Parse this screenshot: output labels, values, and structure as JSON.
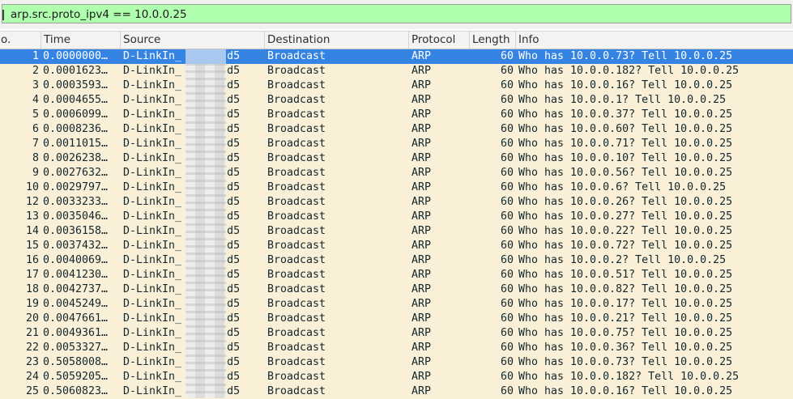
{
  "filter": {
    "value": "arp.src.proto_ipv4 == 10.0.0.25"
  },
  "columns": [
    "o.",
    "Time",
    "Source",
    "Destination",
    "Protocol",
    "Length",
    "Info"
  ],
  "selected_row": 1,
  "rows": [
    {
      "no": "1",
      "time": "0.0000000…",
      "src": "D-LinkIn_",
      "src_tail": ":d5",
      "dst": "Broadcast",
      "proto": "ARP",
      "len": "60",
      "info": "Who has 10.0.0.73? Tell 10.0.0.25"
    },
    {
      "no": "2",
      "time": "0.0001623…",
      "src": "D-LinkIn_",
      "src_tail": ":d5",
      "dst": "Broadcast",
      "proto": "ARP",
      "len": "60",
      "info": "Who has 10.0.0.182? Tell 10.0.0.25"
    },
    {
      "no": "3",
      "time": "0.0003593…",
      "src": "D-LinkIn_",
      "src_tail": ":d5",
      "dst": "Broadcast",
      "proto": "ARP",
      "len": "60",
      "info": "Who has 10.0.0.16? Tell 10.0.0.25"
    },
    {
      "no": "4",
      "time": "0.0004655…",
      "src": "D-LinkIn_",
      "src_tail": ":d5",
      "dst": "Broadcast",
      "proto": "ARP",
      "len": "60",
      "info": "Who has 10.0.0.1? Tell 10.0.0.25"
    },
    {
      "no": "5",
      "time": "0.0006099…",
      "src": "D-LinkIn_",
      "src_tail": ":d5",
      "dst": "Broadcast",
      "proto": "ARP",
      "len": "60",
      "info": "Who has 10.0.0.37? Tell 10.0.0.25"
    },
    {
      "no": "6",
      "time": "0.0008236…",
      "src": "D-LinkIn_",
      "src_tail": ":d5",
      "dst": "Broadcast",
      "proto": "ARP",
      "len": "60",
      "info": "Who has 10.0.0.60? Tell 10.0.0.25"
    },
    {
      "no": "7",
      "time": "0.0011015…",
      "src": "D-LinkIn_",
      "src_tail": ":d5",
      "dst": "Broadcast",
      "proto": "ARP",
      "len": "60",
      "info": "Who has 10.0.0.71? Tell 10.0.0.25"
    },
    {
      "no": "8",
      "time": "0.0026238…",
      "src": "D-LinkIn_",
      "src_tail": ":d5",
      "dst": "Broadcast",
      "proto": "ARP",
      "len": "60",
      "info": "Who has 10.0.0.10? Tell 10.0.0.25"
    },
    {
      "no": "9",
      "time": "0.0027632…",
      "src": "D-LinkIn_",
      "src_tail": ":d5",
      "dst": "Broadcast",
      "proto": "ARP",
      "len": "60",
      "info": "Who has 10.0.0.56? Tell 10.0.0.25"
    },
    {
      "no": "10",
      "time": "0.0029797…",
      "src": "D-LinkIn_",
      "src_tail": ":d5",
      "dst": "Broadcast",
      "proto": "ARP",
      "len": "60",
      "info": "Who has 10.0.0.6? Tell 10.0.0.25"
    },
    {
      "no": "12",
      "time": "0.0033233…",
      "src": "D-LinkIn_",
      "src_tail": ":d5",
      "dst": "Broadcast",
      "proto": "ARP",
      "len": "60",
      "info": "Who has 10.0.0.26? Tell 10.0.0.25"
    },
    {
      "no": "13",
      "time": "0.0035046…",
      "src": "D-LinkIn_",
      "src_tail": ":d5",
      "dst": "Broadcast",
      "proto": "ARP",
      "len": "60",
      "info": "Who has 10.0.0.27? Tell 10.0.0.25"
    },
    {
      "no": "14",
      "time": "0.0036158…",
      "src": "D-LinkIn_",
      "src_tail": ":d5",
      "dst": "Broadcast",
      "proto": "ARP",
      "len": "60",
      "info": "Who has 10.0.0.22? Tell 10.0.0.25"
    },
    {
      "no": "15",
      "time": "0.0037432…",
      "src": "D-LinkIn_",
      "src_tail": ":d5",
      "dst": "Broadcast",
      "proto": "ARP",
      "len": "60",
      "info": "Who has 10.0.0.72? Tell 10.0.0.25"
    },
    {
      "no": "16",
      "time": "0.0040069…",
      "src": "D-LinkIn_",
      "src_tail": ":d5",
      "dst": "Broadcast",
      "proto": "ARP",
      "len": "60",
      "info": "Who has 10.0.0.2? Tell 10.0.0.25"
    },
    {
      "no": "17",
      "time": "0.0041230…",
      "src": "D-LinkIn_",
      "src_tail": ":d5",
      "dst": "Broadcast",
      "proto": "ARP",
      "len": "60",
      "info": "Who has 10.0.0.51? Tell 10.0.0.25"
    },
    {
      "no": "18",
      "time": "0.0042737…",
      "src": "D-LinkIn_",
      "src_tail": ":d5",
      "dst": "Broadcast",
      "proto": "ARP",
      "len": "60",
      "info": "Who has 10.0.0.82? Tell 10.0.0.25"
    },
    {
      "no": "19",
      "time": "0.0045249…",
      "src": "D-LinkIn_",
      "src_tail": ":d5",
      "dst": "Broadcast",
      "proto": "ARP",
      "len": "60",
      "info": "Who has 10.0.0.17? Tell 10.0.0.25"
    },
    {
      "no": "20",
      "time": "0.0047661…",
      "src": "D-LinkIn_",
      "src_tail": ":d5",
      "dst": "Broadcast",
      "proto": "ARP",
      "len": "60",
      "info": "Who has 10.0.0.21? Tell 10.0.0.25"
    },
    {
      "no": "21",
      "time": "0.0049361…",
      "src": "D-LinkIn_",
      "src_tail": ":d5",
      "dst": "Broadcast",
      "proto": "ARP",
      "len": "60",
      "info": "Who has 10.0.0.75? Tell 10.0.0.25"
    },
    {
      "no": "22",
      "time": "0.0053327…",
      "src": "D-LinkIn_",
      "src_tail": ":d5",
      "dst": "Broadcast",
      "proto": "ARP",
      "len": "60",
      "info": "Who has 10.0.0.36? Tell 10.0.0.25"
    },
    {
      "no": "23",
      "time": "0.5058008…",
      "src": "D-LinkIn_",
      "src_tail": ":d5",
      "dst": "Broadcast",
      "proto": "ARP",
      "len": "60",
      "info": "Who has 10.0.0.73? Tell 10.0.0.25"
    },
    {
      "no": "24",
      "time": "0.5059205…",
      "src": "D-LinkIn_",
      "src_tail": ":d5",
      "dst": "Broadcast",
      "proto": "ARP",
      "len": "60",
      "info": "Who has 10.0.0.182? Tell 10.0.0.25"
    },
    {
      "no": "25",
      "time": "0.5060823…",
      "src": "D-LinkIn_",
      "src_tail": ":d5",
      "dst": "Broadcast",
      "proto": "ARP",
      "len": "60",
      "info": "Who has 10.0.0.16? Tell 10.0.0.25"
    }
  ]
}
